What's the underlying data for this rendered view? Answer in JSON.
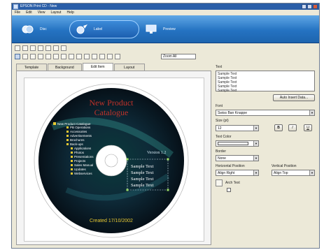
{
  "app": {
    "title": "EPSON Print CD - New"
  },
  "menu": {
    "items": [
      "File",
      "Edit",
      "View",
      "Layout",
      "Help"
    ]
  },
  "modes": [
    {
      "label": "Disc"
    },
    {
      "label": "Label"
    },
    {
      "label": "Preview"
    }
  ],
  "toolbar": {
    "zoom_value": "Zoom All"
  },
  "tabs": [
    "Template",
    "Background",
    "Edit Item",
    "Layout"
  ],
  "disc": {
    "title_line1": "New Product",
    "title_line2": "Catalogue",
    "version": "Version 1.2",
    "created": "Created 17/10/2002",
    "list_items": [
      "New Product Catalogue",
      "PB Operations",
      "Accessories",
      "Advertisements",
      "Brochures",
      "Back-ups",
      "Applications",
      "Photos",
      "Presentations",
      "Projects",
      "Sales Manual",
      "Updates",
      "Webservices"
    ],
    "sample_texts": [
      "Sample Text",
      "Sample Text",
      "Sample Text",
      "Sample Text"
    ]
  },
  "panel": {
    "text_label": "Text",
    "text_lines": [
      "Sample Text",
      "Sample Text",
      "Sample Text",
      "Sample Text",
      "Sample Text"
    ],
    "auto_insert_btn": "Auto Insert Data...",
    "font_label": "Font",
    "font_value": "Swiss Ban Knappe",
    "size_label": "Size (pt)",
    "size_value": "12",
    "bold": "B",
    "italic": "I",
    "underline": "U",
    "color_label": "Text Color",
    "border_label": "Border",
    "border_value": "None",
    "hpos_label": "Horizontal Position",
    "hpos_value": "Align Right",
    "vpos_label": "Vertical Position",
    "vpos_value": "Align Top",
    "arch_label": "Arch Text"
  }
}
